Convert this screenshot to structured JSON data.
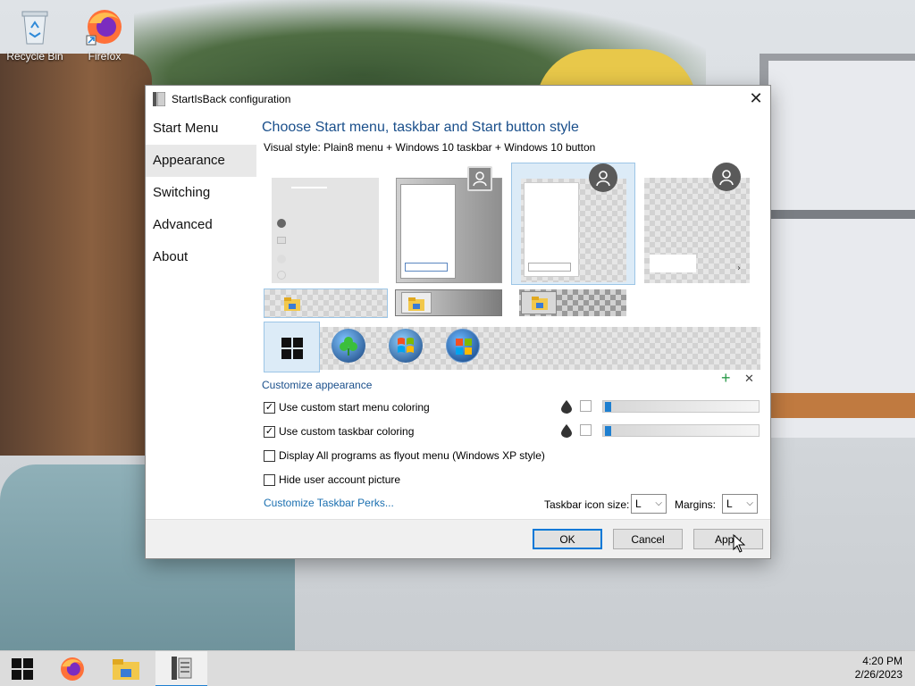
{
  "desktop": {
    "icons": [
      {
        "label": "Recycle Bin",
        "icon": "recycle-bin-icon"
      },
      {
        "label": "Firefox",
        "icon": "firefox-icon"
      }
    ]
  },
  "dialog": {
    "title": "StartIsBack configuration",
    "nav": [
      {
        "label": "Start Menu"
      },
      {
        "label": "Appearance"
      },
      {
        "label": "Switching"
      },
      {
        "label": "Advanced"
      },
      {
        "label": "About"
      }
    ],
    "active_nav": "Appearance",
    "heading": "Choose Start menu, taskbar and Start button style",
    "visual_style": "Visual style:  Plain8 menu + Windows 10 taskbar + Windows 10 button",
    "customize_heading": "Customize appearance",
    "add_symbol": "+",
    "remove_symbol": "✕",
    "options": [
      {
        "label": "Use custom start menu coloring",
        "checked": true
      },
      {
        "label": "Use custom taskbar coloring",
        "checked": true
      },
      {
        "label": "Display All programs as flyout menu (Windows XP style)",
        "checked": false
      },
      {
        "label": "Hide user account picture",
        "checked": false
      }
    ],
    "perks_link": "Customize Taskbar Perks...",
    "taskbar_icon_size_label": "Taskbar icon size:",
    "taskbar_icon_size_value": "L",
    "margins_label": "Margins:",
    "margins_value": "L",
    "buttons": {
      "ok": "OK",
      "cancel": "Cancel",
      "apply": "Apply"
    },
    "close_glyph": "✕"
  },
  "taskbar": {
    "time": "4:20 PM",
    "date": "2/26/2023",
    "accent": "#1e7fd0"
  }
}
